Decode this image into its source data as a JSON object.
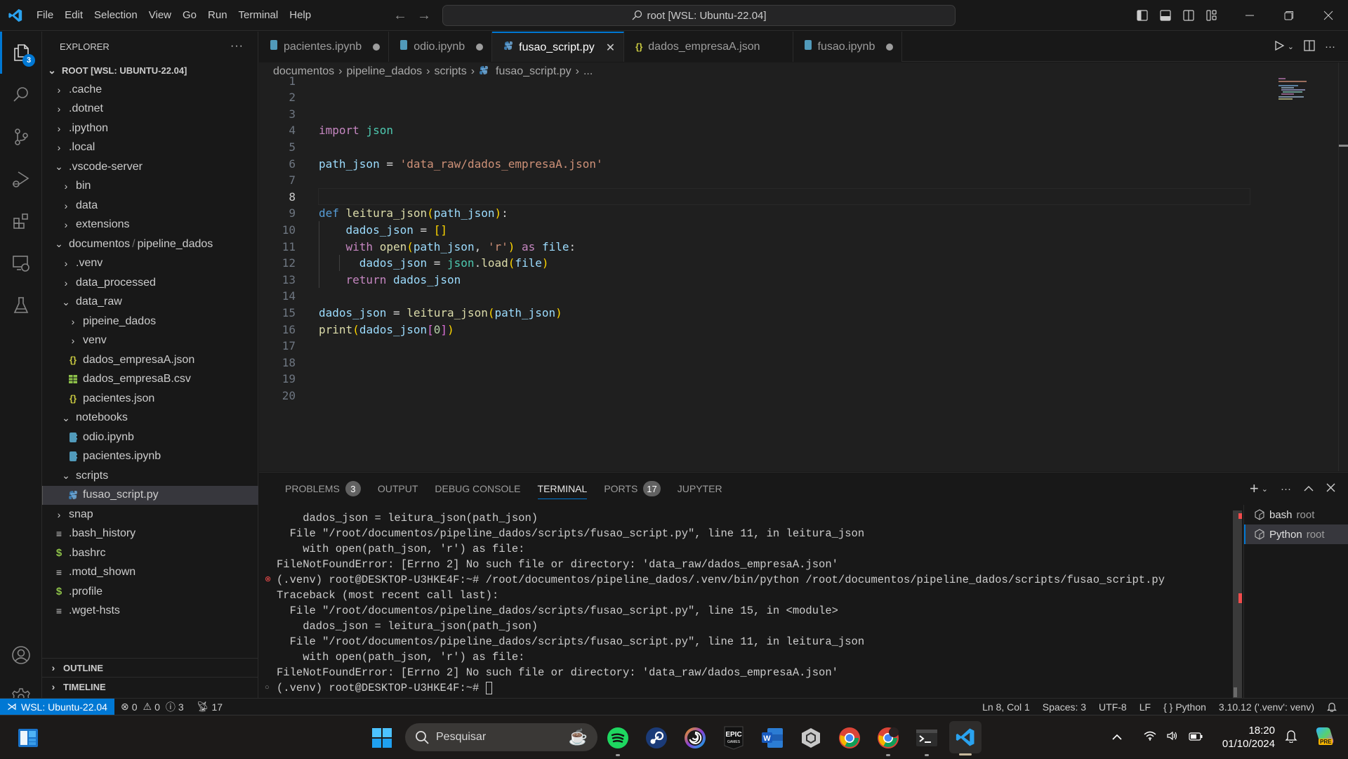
{
  "window": {
    "search_label": "root [WSL: Ubuntu-22.04]",
    "menu": [
      "File",
      "Edit",
      "Selection",
      "View",
      "Go",
      "Run",
      "Terminal",
      "Help"
    ]
  },
  "activity_bar": {
    "explorer_badge": "3",
    "items": [
      "explorer-icon",
      "search-icon",
      "source-control-icon",
      "run-debug-icon",
      "extensions-icon",
      "remote-explorer-icon",
      "testing-icon"
    ],
    "bottom": [
      "account-icon",
      "settings-gear-icon"
    ]
  },
  "sidebar": {
    "title": "EXPLORER",
    "more": "···",
    "root_label": "ROOT [WSL: UBUNTU-22.04]",
    "tree": [
      {
        "label": ".cache",
        "type": "folder",
        "open": false,
        "depth": 1
      },
      {
        "label": ".dotnet",
        "type": "folder",
        "open": false,
        "depth": 1
      },
      {
        "label": ".ipython",
        "type": "folder",
        "open": false,
        "depth": 1
      },
      {
        "label": ".local",
        "type": "folder",
        "open": false,
        "depth": 1
      },
      {
        "label": ".vscode-server",
        "type": "folder",
        "open": true,
        "depth": 1
      },
      {
        "label": "bin",
        "type": "folder",
        "open": false,
        "depth": 2
      },
      {
        "label": "data",
        "type": "folder",
        "open": false,
        "depth": 2
      },
      {
        "label": "extensions",
        "type": "folder",
        "open": false,
        "depth": 2
      },
      {
        "label": "documentos",
        "label2": "pipeline_dados",
        "type": "folder",
        "open": true,
        "depth": 1
      },
      {
        "label": ".venv",
        "type": "folder",
        "open": false,
        "depth": 2
      },
      {
        "label": "data_processed",
        "type": "folder",
        "open": false,
        "depth": 2
      },
      {
        "label": "data_raw",
        "type": "folder",
        "open": true,
        "depth": 2
      },
      {
        "label": "pipeine_dados",
        "type": "folder",
        "open": false,
        "depth": 3
      },
      {
        "label": "venv",
        "type": "folder",
        "open": false,
        "depth": 3
      },
      {
        "label": "dados_empresaA.json",
        "type": "json",
        "depth": 3
      },
      {
        "label": "dados_empresaB.csv",
        "type": "csv",
        "depth": 3
      },
      {
        "label": "pacientes.json",
        "type": "json",
        "depth": 3
      },
      {
        "label": "notebooks",
        "type": "folder",
        "open": true,
        "depth": 2
      },
      {
        "label": "odio.ipynb",
        "type": "notebook",
        "depth": 3
      },
      {
        "label": "pacientes.ipynb",
        "type": "notebook",
        "depth": 3
      },
      {
        "label": "scripts",
        "type": "folder",
        "open": true,
        "depth": 2
      },
      {
        "label": "fusao_script.py",
        "type": "python",
        "depth": 3,
        "selected": true
      },
      {
        "label": "snap",
        "type": "folder",
        "open": false,
        "depth": 1
      },
      {
        "label": ".bash_history",
        "type": "text",
        "depth": 1
      },
      {
        "label": ".bashrc",
        "type": "shell",
        "depth": 1
      },
      {
        "label": ".motd_shown",
        "type": "text",
        "depth": 1
      },
      {
        "label": ".profile",
        "type": "shell",
        "depth": 1
      },
      {
        "label": ".wget-hsts",
        "type": "text",
        "depth": 1
      }
    ],
    "outline_label": "OUTLINE",
    "timeline_label": "TIMELINE"
  },
  "tabs": [
    {
      "label": "pacientes.ipynb",
      "icon": "notebook",
      "dirty": true,
      "active": false
    },
    {
      "label": "odio.ipynb",
      "icon": "notebook",
      "dirty": true,
      "active": false
    },
    {
      "label": "fusao_script.py",
      "icon": "python",
      "dirty": false,
      "active": true
    },
    {
      "label": "dados_empresaA.json",
      "icon": "json",
      "dirty": false,
      "active": false
    },
    {
      "label": "fusao.ipynb",
      "icon": "notebook",
      "dirty": true,
      "active": false
    }
  ],
  "breadcrumb": [
    "documentos",
    "pipeline_dados",
    "scripts",
    "fusao_script.py",
    "..."
  ],
  "editor": {
    "current_line": 8,
    "lines": [
      {
        "n": "1",
        "tokens": []
      },
      {
        "n": "2",
        "tokens": []
      },
      {
        "n": "3",
        "tokens": []
      },
      {
        "n": "4",
        "tokens": [
          [
            "k-import",
            "import"
          ],
          [
            "k-pun",
            " "
          ],
          [
            "k-mod",
            "json"
          ]
        ]
      },
      {
        "n": "5",
        "tokens": []
      },
      {
        "n": "6",
        "tokens": [
          [
            "k-var",
            "path_json"
          ],
          [
            "k-pun",
            " = "
          ],
          [
            "k-str",
            "'data_raw/dados_empresaA.json'"
          ]
        ]
      },
      {
        "n": "7",
        "tokens": []
      },
      {
        "n": "8",
        "tokens": []
      },
      {
        "n": "9",
        "tokens": [
          [
            "k-def",
            "def"
          ],
          [
            "k-pun",
            " "
          ],
          [
            "k-fn",
            "leitura_json"
          ],
          [
            "k-br",
            "("
          ],
          [
            "k-var",
            "path_json"
          ],
          [
            "k-br",
            ")"
          ],
          [
            "k-pun",
            ":"
          ]
        ]
      },
      {
        "n": "10",
        "tokens": [
          [
            "k-pun",
            "    "
          ],
          [
            "k-var",
            "dados_json"
          ],
          [
            "k-pun",
            " = "
          ],
          [
            "k-br",
            "[]"
          ]
        ]
      },
      {
        "n": "11",
        "tokens": [
          [
            "k-pun",
            "    "
          ],
          [
            "k-import",
            "with"
          ],
          [
            "k-pun",
            " "
          ],
          [
            "k-fn",
            "open"
          ],
          [
            "k-br",
            "("
          ],
          [
            "k-var",
            "path_json"
          ],
          [
            "k-pun",
            ", "
          ],
          [
            "k-str",
            "'r'"
          ],
          [
            "k-br",
            ")"
          ],
          [
            "k-pun",
            " "
          ],
          [
            "k-import",
            "as"
          ],
          [
            "k-pun",
            " "
          ],
          [
            "k-var",
            "file"
          ],
          [
            "k-pun",
            ":"
          ]
        ]
      },
      {
        "n": "12",
        "tokens": [
          [
            "k-pun",
            "      "
          ],
          [
            "k-var",
            "dados_json"
          ],
          [
            "k-pun",
            " = "
          ],
          [
            "k-mod",
            "json"
          ],
          [
            "k-pun",
            "."
          ],
          [
            "k-fn",
            "load"
          ],
          [
            "k-br",
            "("
          ],
          [
            "k-var",
            "file"
          ],
          [
            "k-br",
            ")"
          ]
        ]
      },
      {
        "n": "13",
        "tokens": [
          [
            "k-pun",
            "    "
          ],
          [
            "k-import",
            "return"
          ],
          [
            "k-pun",
            " "
          ],
          [
            "k-var",
            "dados_json"
          ]
        ]
      },
      {
        "n": "14",
        "tokens": []
      },
      {
        "n": "15",
        "tokens": [
          [
            "k-var",
            "dados_json"
          ],
          [
            "k-pun",
            " = "
          ],
          [
            "k-fn",
            "leitura_json"
          ],
          [
            "k-br",
            "("
          ],
          [
            "k-var",
            "path_json"
          ],
          [
            "k-br",
            ")"
          ]
        ]
      },
      {
        "n": "16",
        "tokens": [
          [
            "k-fn",
            "print"
          ],
          [
            "k-br",
            "("
          ],
          [
            "k-var",
            "dados_json"
          ],
          [
            "k-br2",
            "["
          ],
          [
            "k-num",
            "0"
          ],
          [
            "k-br2",
            "]"
          ],
          [
            "k-br",
            ")"
          ]
        ]
      },
      {
        "n": "17",
        "tokens": []
      },
      {
        "n": "18",
        "tokens": []
      },
      {
        "n": "19",
        "tokens": []
      },
      {
        "n": "20",
        "tokens": []
      }
    ]
  },
  "panel": {
    "tabs": [
      {
        "label": "PROBLEMS",
        "badge": "3"
      },
      {
        "label": "OUTPUT"
      },
      {
        "label": "DEBUG CONSOLE"
      },
      {
        "label": "TERMINAL",
        "active": true
      },
      {
        "label": "PORTS",
        "badge": "17"
      },
      {
        "label": "JUPYTER"
      }
    ],
    "terminal_lines": [
      {
        "text": "    dados_json = leitura_json(path_json)"
      },
      {
        "text": "  File \"/root/documentos/pipeline_dados/scripts/fusao_script.py\", line 11, in leitura_json"
      },
      {
        "text": "    with open(path_json, 'r') as file:"
      },
      {
        "text": "FileNotFoundError: [Errno 2] No such file or directory: 'data_raw/dados_empresaA.json'"
      },
      {
        "text": "(.venv) root@DESKTOP-U3HKE4F:~# /root/documentos/pipeline_dados/.venv/bin/python /root/documentos/pipeline_dados/scripts/fusao_script.py",
        "mark": "error"
      },
      {
        "text": "Traceback (most recent call last):"
      },
      {
        "text": "  File \"/root/documentos/pipeline_dados/scripts/fusao_script.py\", line 15, in <module>"
      },
      {
        "text": "    dados_json = leitura_json(path_json)"
      },
      {
        "text": "  File \"/root/documentos/pipeline_dados/scripts/fusao_script.py\", line 11, in leitura_json"
      },
      {
        "text": "    with open(path_json, 'r') as file:"
      },
      {
        "text": "FileNotFoundError: [Errno 2] No such file or directory: 'data_raw/dados_empresaA.json'"
      },
      {
        "text": "(.venv) root@DESKTOP-U3HKE4F:~# ",
        "mark": "idle",
        "cursor": true
      }
    ],
    "terminals": [
      {
        "name": "bash",
        "user": "root",
        "selected": false
      },
      {
        "name": "Python",
        "user": "root",
        "selected": true
      }
    ]
  },
  "statusbar": {
    "remote": "WSL: Ubuntu-22.04",
    "errors": "0",
    "warnings": "0",
    "infos": "3",
    "ports": "17",
    "position": "Ln 8, Col 1",
    "spaces": "Spaces: 3",
    "encoding": "UTF-8",
    "eol": "LF",
    "language": "Python",
    "interpreter": "3.10.12 ('.venv': venv)"
  },
  "taskbar": {
    "search_placeholder": "Pesquisar",
    "time": "18:20",
    "date": "01/10/2024",
    "copilot_badge": "PRE",
    "apps": [
      "spotify",
      "steam",
      "ubisoft-connect",
      "epic-games",
      "word",
      "unity-hub",
      "chrome",
      "chrome-profile",
      "terminal",
      "vscode"
    ]
  }
}
